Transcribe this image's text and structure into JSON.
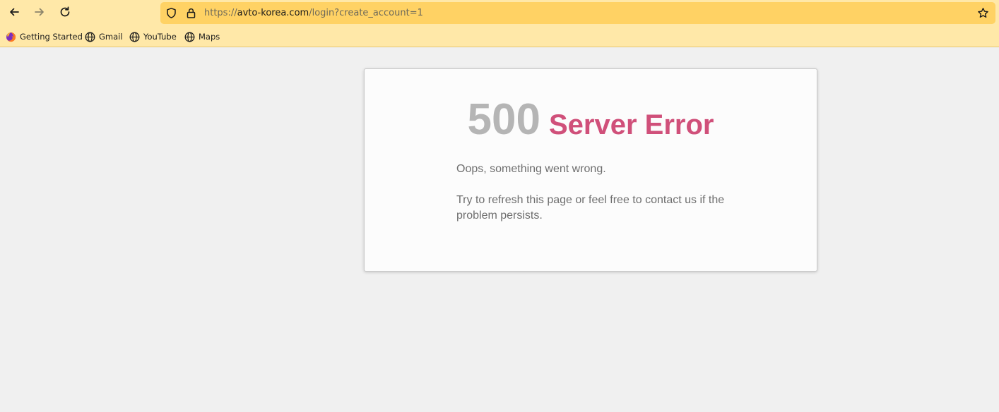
{
  "browser": {
    "url_scheme": "https://",
    "url_host": "avto-korea.com",
    "url_path": "/login?create_account=1",
    "icons": {
      "back": "back-arrow-icon",
      "forward": "forward-arrow-icon",
      "reload": "reload-icon",
      "shield": "shield-icon",
      "lock": "lock-icon",
      "bookmark_star": "star-icon"
    },
    "bookmarks": [
      {
        "label": "Getting Started",
        "icon": "firefox-icon"
      },
      {
        "label": "Gmail",
        "icon": "globe-icon"
      },
      {
        "label": "YouTube",
        "icon": "globe-icon"
      },
      {
        "label": "Maps",
        "icon": "globe-icon"
      }
    ],
    "colors": {
      "toolbar": "#ffe8a8",
      "urlbar": "#ffd264"
    }
  },
  "error": {
    "code": "500",
    "title": "Server Error",
    "message_1": "Oops, something went wrong.",
    "message_2": "Try to refresh this page or feel free to contact us if the problem persists.",
    "colors": {
      "code": "#b5b5b5",
      "title": "#d0507a",
      "text": "#6e6e6e"
    }
  }
}
